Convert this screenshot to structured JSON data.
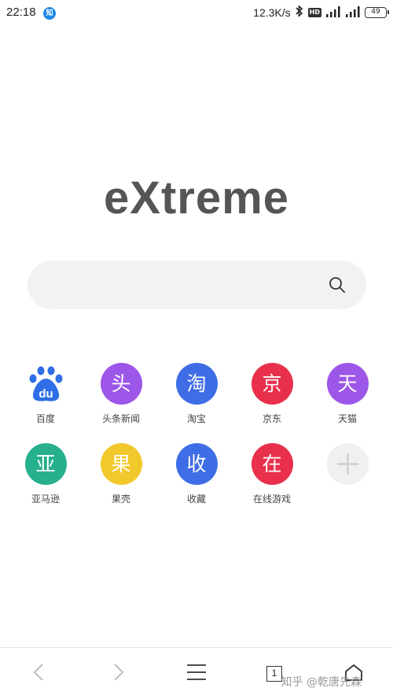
{
  "status_bar": {
    "time": "22:18",
    "notification_app": "知",
    "net_speed": "12.3K/s",
    "hd_badge": "HD",
    "battery": "49"
  },
  "logo": "eXtreme",
  "search": {
    "placeholder": ""
  },
  "shortcuts": [
    {
      "label": "百度",
      "icon": "baidu-icon",
      "glyph": "du",
      "color": "#2f6ee6"
    },
    {
      "label": "头条新闻",
      "icon": "toutiao-icon",
      "glyph": "头",
      "color": "#9c56e8"
    },
    {
      "label": "淘宝",
      "icon": "taobao-icon",
      "glyph": "淘",
      "color": "#3f6de6"
    },
    {
      "label": "京东",
      "icon": "jd-icon",
      "glyph": "京",
      "color": "#e8304c"
    },
    {
      "label": "天猫",
      "icon": "tmall-icon",
      "glyph": "天",
      "color": "#9c56e8"
    },
    {
      "label": "亚马逊",
      "icon": "amazon-icon",
      "glyph": "亚",
      "color": "#26b08c"
    },
    {
      "label": "果壳",
      "icon": "guokr-icon",
      "glyph": "果",
      "color": "#f2c92d"
    },
    {
      "label": "收藏",
      "icon": "favorites-icon",
      "glyph": "收",
      "color": "#3f6de6"
    },
    {
      "label": "在线游戏",
      "icon": "games-icon",
      "glyph": "在",
      "color": "#e8304c"
    },
    {
      "label": "",
      "icon": "add-icon",
      "glyph": "",
      "color": "#f0f0f0"
    }
  ],
  "bottom_nav": {
    "tab_count": "1"
  },
  "watermark": "知乎 @乾唐先森"
}
